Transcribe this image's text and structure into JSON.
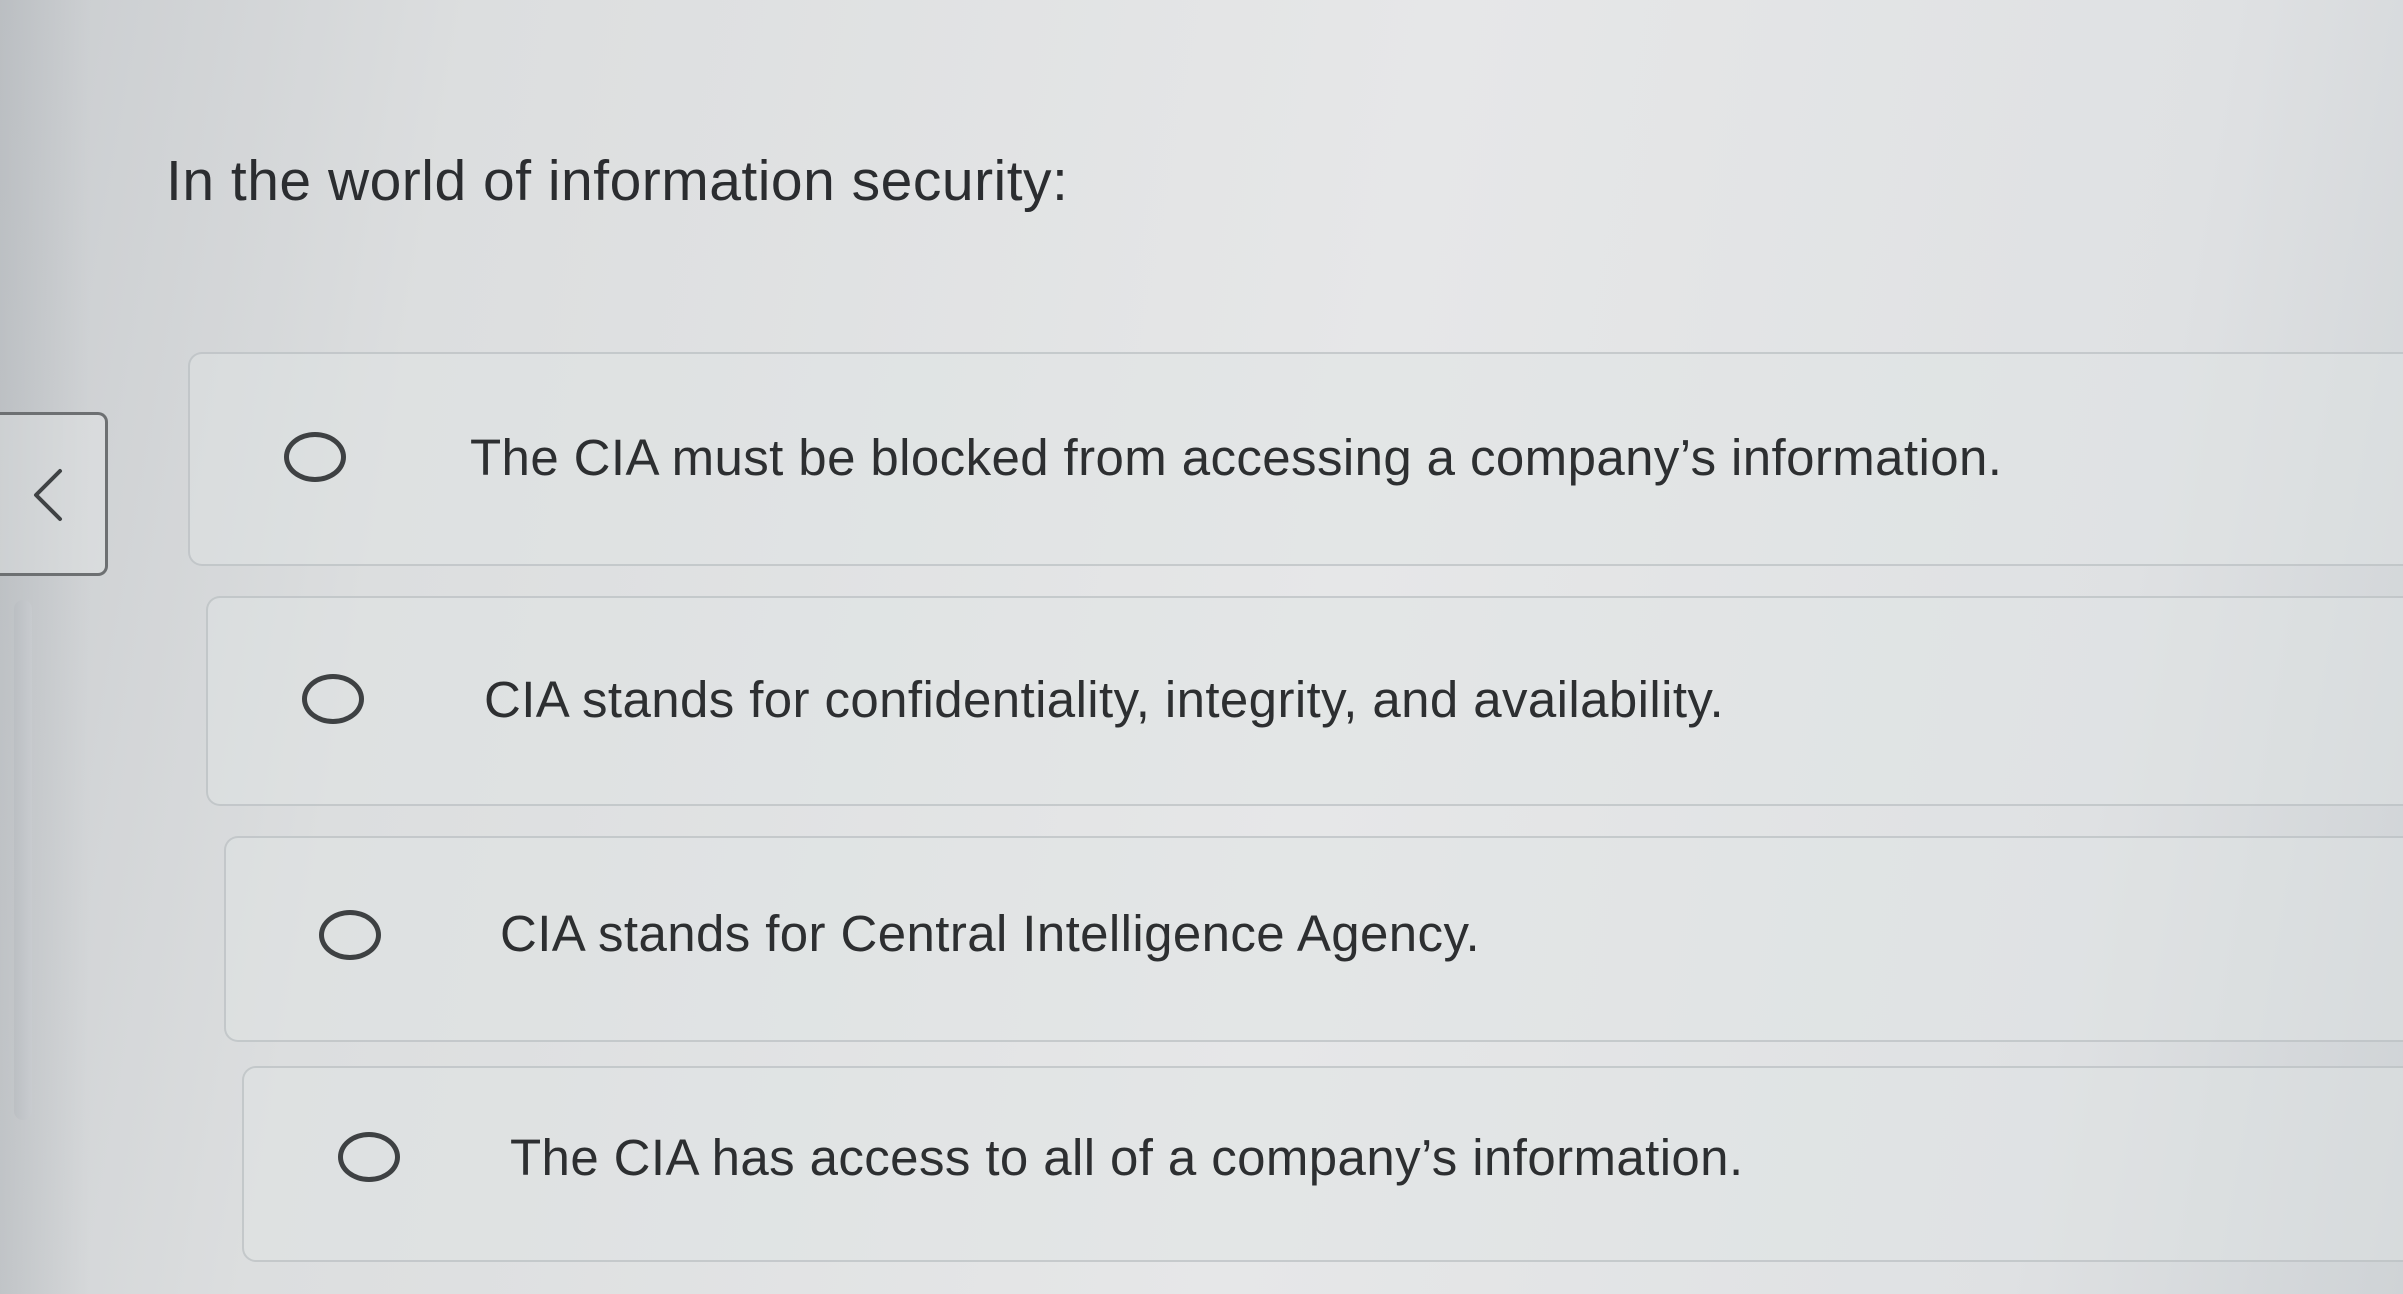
{
  "question": {
    "prompt": "In the world of information security:"
  },
  "navigation": {
    "back_icon": "chevron-left-icon"
  },
  "options": [
    {
      "label": "The CIA must be blocked from accessing a company’s information.",
      "selected": false
    },
    {
      "label": "CIA stands for confidentiality, integrity, and availability.",
      "selected": false
    },
    {
      "label": "CIA stands for Central Intelligence Agency.",
      "selected": false
    },
    {
      "label": "The CIA has access to all of a company’s information.",
      "selected": false
    }
  ],
  "colors": {
    "background": "#e3e5e6",
    "text": "#2d2f31",
    "radio_border": "#3e4143",
    "card_border": "#b4b8bc"
  }
}
